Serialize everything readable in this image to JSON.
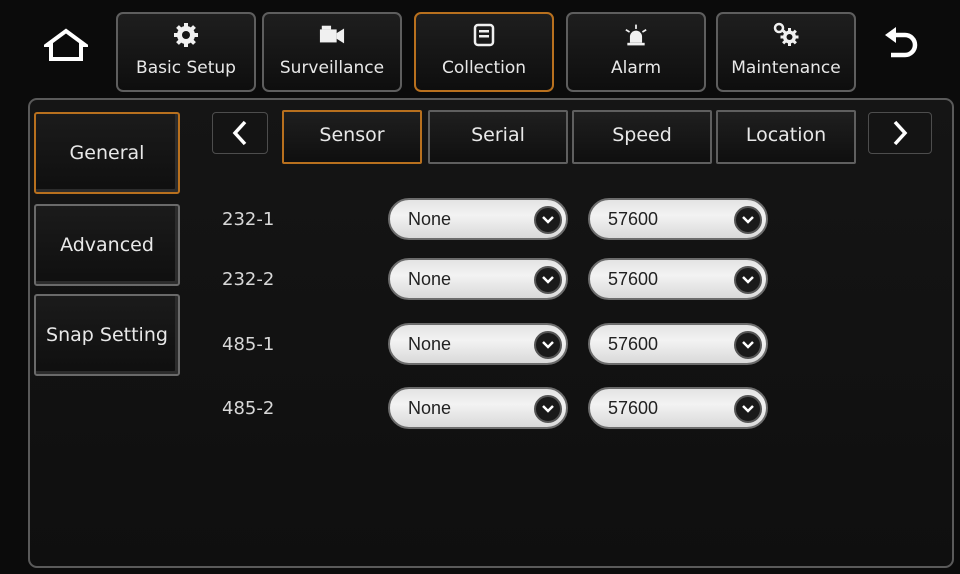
{
  "top_tabs": [
    {
      "label": "Basic Setup",
      "icon": "gear-icon"
    },
    {
      "label": "Surveillance",
      "icon": "camera-icon"
    },
    {
      "label": "Collection",
      "icon": "document-icon"
    },
    {
      "label": "Alarm",
      "icon": "alarm-light-icon"
    },
    {
      "label": "Maintenance",
      "icon": "tools-gear-icon"
    }
  ],
  "side_menu": [
    {
      "label": "General"
    },
    {
      "label": "Advanced"
    },
    {
      "label": "Snap Setting"
    }
  ],
  "sub_tabs": [
    {
      "label": "Sensor"
    },
    {
      "label": "Serial"
    },
    {
      "label": "Speed"
    },
    {
      "label": "Location"
    }
  ],
  "rows": [
    {
      "port": "232-1",
      "device": "None",
      "baud": "57600"
    },
    {
      "port": "232-2",
      "device": "None",
      "baud": "57600"
    },
    {
      "port": "485-1",
      "device": "None",
      "baud": "57600"
    },
    {
      "port": "485-2",
      "device": "None",
      "baud": "57600"
    }
  ],
  "colors": {
    "accent": "#b8701e",
    "background": "#0b0b0b",
    "border": "#5e5e5e",
    "dropdown_fill": "#ececec"
  }
}
